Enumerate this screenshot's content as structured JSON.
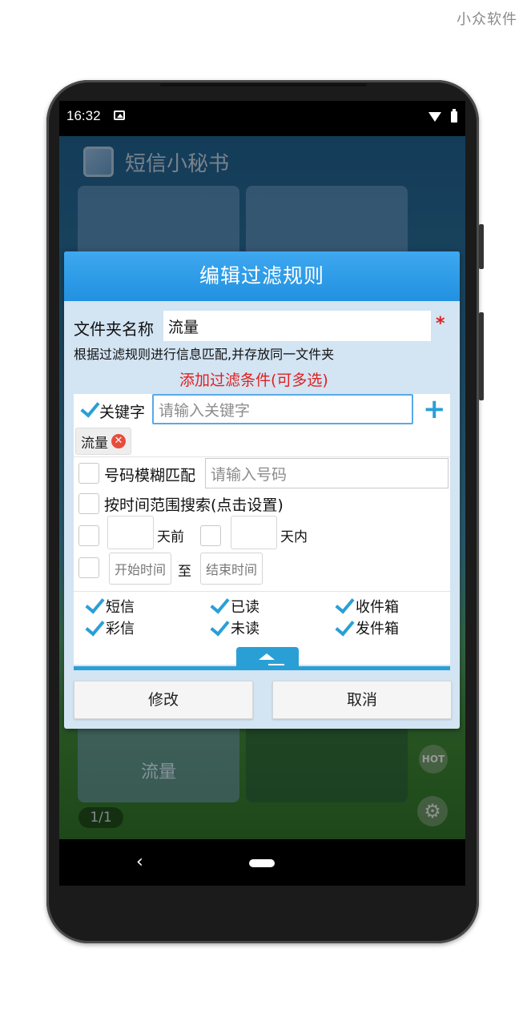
{
  "watermark": "小众软件",
  "status_bar": {
    "time": "16:32"
  },
  "app": {
    "title": "短信小秘书",
    "tiles": [
      {
        "label": ""
      },
      {
        "label": ""
      },
      {
        "label": "流量"
      },
      {
        "label": ""
      }
    ],
    "page_indicator": "1/1",
    "hot_label": "HOT"
  },
  "dialog": {
    "title": "编辑过滤规则",
    "folder_name_label": "文件夹名称",
    "folder_name_value": "流量",
    "required_mark": "*",
    "description": "根据过滤规则进行信息匹配,并存放同一文件夹",
    "add_conditions_label": "添加过滤条件(可多选)",
    "keyword": {
      "label": "关键字",
      "checked": true,
      "placeholder": "请输入关键字",
      "chips": [
        "流量"
      ]
    },
    "number_match": {
      "label": "号码模糊匹配",
      "checked": false,
      "placeholder": "请输入号码"
    },
    "time_range": {
      "label": "按时间范围搜索(点击设置)",
      "checked": false,
      "days_before_label": "天前",
      "days_within_label": "天内",
      "start_time_label": "开始时间",
      "to_label": "至",
      "end_time_label": "结束时间"
    },
    "types": [
      {
        "label": "短信",
        "checked": true
      },
      {
        "label": "已读",
        "checked": true
      },
      {
        "label": "收件箱",
        "checked": true
      },
      {
        "label": "彩信",
        "checked": true
      },
      {
        "label": "未读",
        "checked": true
      },
      {
        "label": "发件箱",
        "checked": true
      }
    ],
    "buttons": {
      "modify": "修改",
      "cancel": "取消"
    }
  }
}
